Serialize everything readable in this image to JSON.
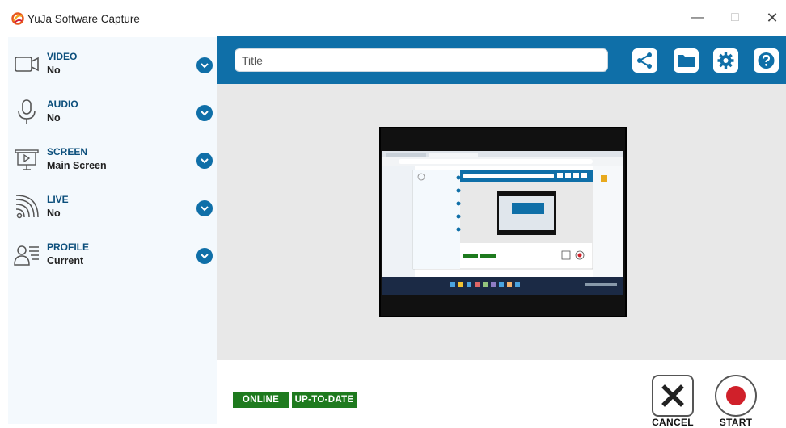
{
  "window": {
    "title": "YuJa Software Capture"
  },
  "sidebar": {
    "items": [
      {
        "label": "VIDEO",
        "value": "No",
        "icon": "video-camera-icon"
      },
      {
        "label": "AUDIO",
        "value": "No",
        "icon": "microphone-icon"
      },
      {
        "label": "SCREEN",
        "value": "Main Screen",
        "icon": "screen-icon"
      },
      {
        "label": "LIVE",
        "value": "No",
        "icon": "live-broadcast-icon"
      },
      {
        "label": "PROFILE",
        "value": "Current",
        "icon": "profile-icon"
      }
    ]
  },
  "header": {
    "title_placeholder": "Title",
    "buttons": [
      "share-icon",
      "folder-icon",
      "gear-icon",
      "help-icon"
    ]
  },
  "status": {
    "online": "ONLINE",
    "uptodate": "UP-TO-DATE"
  },
  "actions": {
    "cancel": "CANCEL",
    "start": "START"
  },
  "colors": {
    "accent": "#0f6fa8",
    "status_green": "#1e7a1e",
    "record_red": "#d0202a"
  }
}
